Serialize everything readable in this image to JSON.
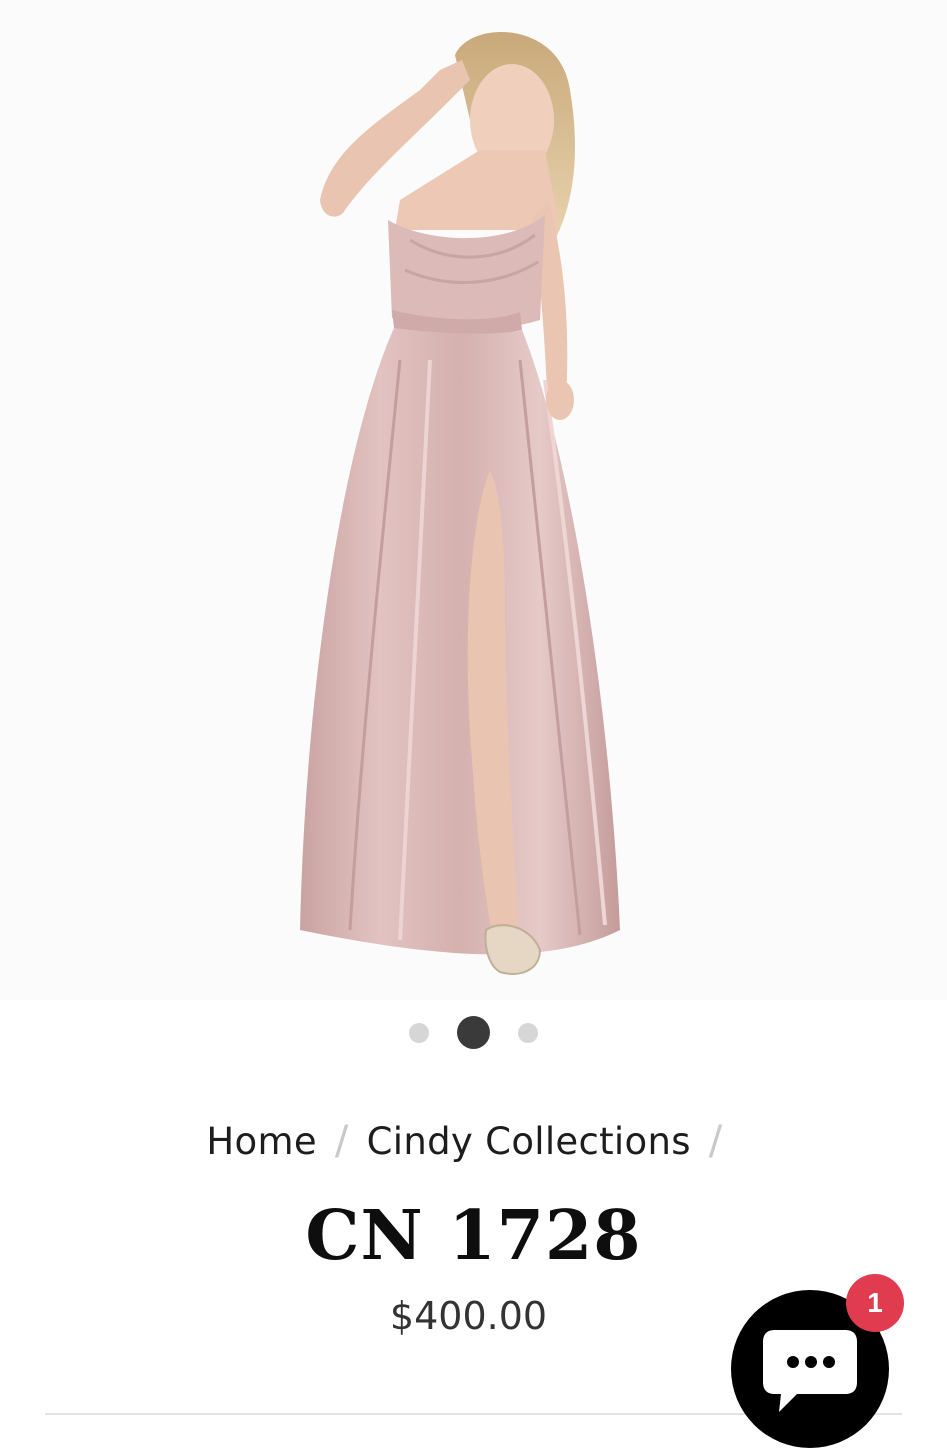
{
  "gallery": {
    "slide_count": 3,
    "active_slide": 2,
    "image_subject": "pink-satin-gown-model",
    "colors": {
      "dress": "#d9b3b1",
      "background": "#fbfbfb"
    }
  },
  "breadcrumb": {
    "items": [
      "Home",
      "Cindy Collections"
    ],
    "separator": "/"
  },
  "product": {
    "title": "CN 1728",
    "price": "$400.00"
  },
  "chat": {
    "icon": "chat-bubble-icon",
    "unread_count": "1",
    "badge_color": "#e03b4e"
  }
}
